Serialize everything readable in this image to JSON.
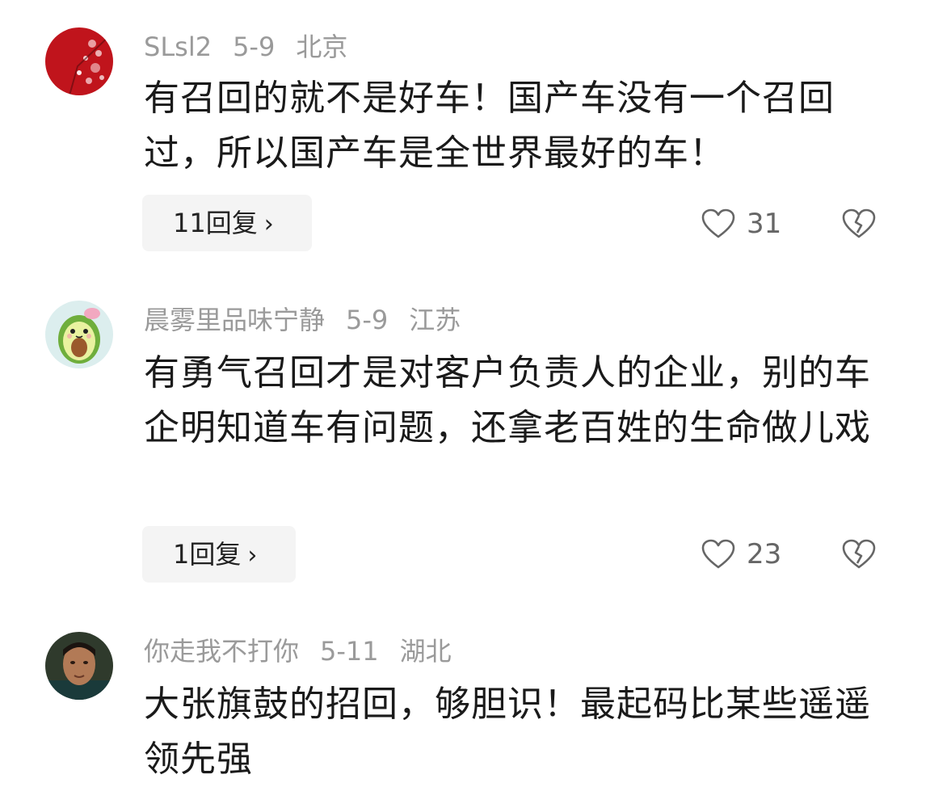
{
  "comments": [
    {
      "username": "SLsl2",
      "date": "5-9",
      "location": "北京",
      "avatar": "red-plum-blossom-avatar",
      "content": "有召回的就不是好车！国产车没有一个召回过，所以国产车是全世界最好的车！",
      "replies_label": "11回复",
      "likes": "31"
    },
    {
      "username": "晨雾里品味宁静",
      "date": "5-9",
      "location": "江苏",
      "avatar": "avocado-cartoon-avatar",
      "content": "有勇气召回才是对客户负责人的企业，别的车企明知道车有问题，还拿老百姓的生命做儿戏",
      "replies_label": "1回复",
      "likes": "23"
    },
    {
      "username": "你走我不打你",
      "date": "5-11",
      "location": "湖北",
      "avatar": "person-photo-avatar",
      "content": "大张旗鼓的招回，够胆识！最起码比某些遥遥领先强"
    }
  ],
  "icons": {
    "like": "heart-outline-icon",
    "dislike": "broken-heart-icon",
    "reply_chevron": "chevron-right-icon"
  },
  "colors": {
    "meta_text": "#9a9a9a",
    "body_text": "#1a1a1a",
    "reply_bg": "#f4f4f4"
  }
}
